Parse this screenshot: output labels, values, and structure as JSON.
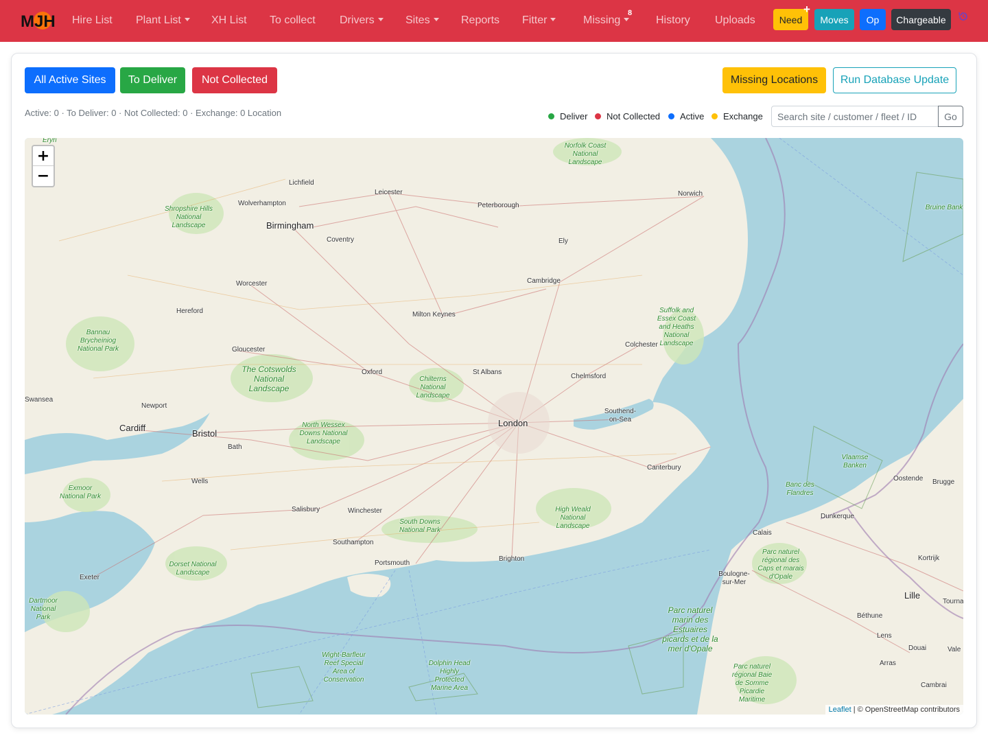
{
  "nav": {
    "logo": "MJH",
    "items": {
      "hire_list": "Hire List",
      "plant_list": "Plant List",
      "xh_list": "XH List",
      "to_collect": "To collect",
      "drivers": "Drivers",
      "sites": "Sites",
      "reports": "Reports",
      "fitter": "Fitter",
      "missing": "Missing",
      "history": "History",
      "uploads": "Uploads"
    },
    "missing_badge": "8",
    "buttons": {
      "need": "Need",
      "need_plus": "+",
      "moves": "Moves",
      "op": "Op",
      "chargeable": "Chargeable"
    }
  },
  "filters": {
    "all_active": "All Active Sites",
    "to_deliver": "To Deliver",
    "not_collected": "Not Collected",
    "missing_locations": "Missing Locations",
    "run_update": "Run Database Update"
  },
  "counts_text": "Active: 0 · To Deliver: 0 · Not Collected: 0 · Exchange: 0 Location",
  "legend": [
    {
      "label": "Deliver",
      "color": "#28a745"
    },
    {
      "label": "Not Collected",
      "color": "#dc3545"
    },
    {
      "label": "Active",
      "color": "#0d6efd"
    },
    {
      "label": "Exchange",
      "color": "#ffc107"
    }
  ],
  "search": {
    "placeholder": "Search site / customer / fleet / ID",
    "go": "Go"
  },
  "map": {
    "zoom_in": "+",
    "zoom_out": "−",
    "attribution_leaflet": "Leaflet",
    "attribution_osm": "| © OpenStreetMap contributors",
    "places": {
      "birmingham": "Birmingham",
      "london": "London",
      "bristol": "Bristol",
      "cardiff": "Cardiff",
      "lichfield": "Lichfield",
      "leicester": "Leicester",
      "wolverhampton": "Wolverhampton",
      "peterborough": "Peterborough",
      "norwich": "Norwich",
      "coventry": "Coventry",
      "ely": "Ely",
      "worcester": "Worcester",
      "cambridge": "Cambridge",
      "hereford": "Hereford",
      "milton_keynes": "Milton Keynes",
      "gloucester": "Gloucester",
      "colchester": "Colchester",
      "oxford": "Oxford",
      "st_albans": "St Albans",
      "chelmsford": "Chelmsford",
      "swansea": "Swansea",
      "newport": "Newport",
      "southend": "Southend-on-Sea",
      "bath": "Bath",
      "canterbury": "Canterbury",
      "wells": "Wells",
      "oostende": "Oostende",
      "brugge": "Brugge",
      "salisbury": "Salisbury",
      "winchester": "Winchester",
      "dunkerque": "Dunkerque",
      "calais": "Calais",
      "southampton": "Southampton",
      "brighton": "Brighton",
      "portsmouth": "Portsmouth",
      "kortrijk": "Kortrijk",
      "exeter": "Exeter",
      "boulogne": "Boulogne-sur-Mer",
      "lille": "Lille",
      "tourna": "Tourna",
      "bethune": "Béthune",
      "lens": "Lens",
      "douai": "Douai",
      "arras": "Arras",
      "cambrai": "Cambrai",
      "vale": "Vale",
      "eryri": "Eryri"
    },
    "parks": {
      "norfolk": "Norfolk Coast National Landscape",
      "shropshire": "Shropshire Hills National Landscape",
      "bannau": "Bannau Brycheiniog National Park",
      "cotswolds": "The Cotswolds National Landscape",
      "chilterns": "Chilterns National Landscape",
      "suffolk": "Suffolk and Essex Coast and Heaths National Landscape",
      "north_wessex": "North Wessex Downs National Landscape",
      "exmoor": "Exmoor National Park",
      "high_weald": "High Weald National Landscape",
      "south_downs": "South Downs National Park",
      "dorset": "Dorset National Landscape",
      "dartmoor": "Dartmoor National Park",
      "vlaamse": "Vlaamse Banken",
      "flandres": "Banc des Flandres",
      "caps": "Parc naturel régional des Caps et marais d'Opale",
      "estuaires": "Parc naturel marin des Estuaires picards et de la mer d'Opale",
      "somme": "Parc naturel régional Baie de Somme Picardie Maritime",
      "wight": "Wight-Barfleur Reef Special Area of Conservation",
      "dolphin": "Dolphin Head Highly Protected Marine Area",
      "bruine": "Bruine Bank"
    }
  }
}
